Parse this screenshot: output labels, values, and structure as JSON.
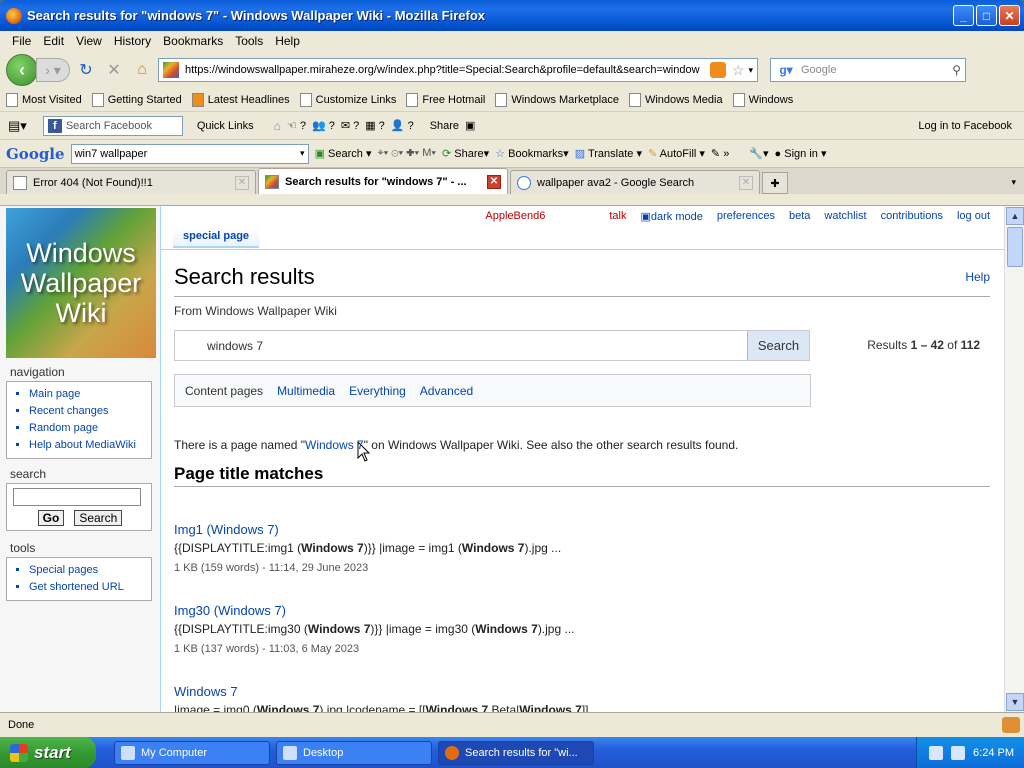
{
  "window": {
    "title": "Search results for \"windows 7\" - Windows Wallpaper Wiki - Mozilla Firefox"
  },
  "menu": [
    "File",
    "Edit",
    "View",
    "History",
    "Bookmarks",
    "Tools",
    "Help"
  ],
  "navbar": {
    "url": "https://windowswallpaper.miraheze.org/w/index.php?title=Special:Search&profile=default&search=window",
    "search_placeholder": "Google"
  },
  "bookmarks": [
    "Most Visited",
    "Getting Started",
    "Latest Headlines",
    "Customize Links",
    "Free Hotmail",
    "Windows Marketplace",
    "Windows Media",
    "Windows"
  ],
  "fbbar": {
    "search_placeholder": "Search Facebook",
    "quick_links": "Quick Links",
    "share": "Share",
    "login": "Log in to Facebook"
  },
  "gbar": {
    "logo": "Google",
    "query": "win7 wallpaper",
    "search": "Search",
    "share": "Share",
    "bookmarks": "Bookmarks",
    "translate": "Translate",
    "autofill": "AutoFill",
    "signin": "Sign in"
  },
  "tabs": [
    {
      "label": "Error 404 (Not Found)!!1"
    },
    {
      "label": "Search results for \"windows 7\" - ..."
    },
    {
      "label": "wallpaper ava2 - Google Search"
    }
  ],
  "sidebar": {
    "logo_lines": [
      "Windows",
      "Wallpaper",
      "Wiki"
    ],
    "navigation_title": "navigation",
    "navigation": [
      "Main page",
      "Recent changes",
      "Random page",
      "Help about MediaWiki"
    ],
    "search_title": "search",
    "go": "Go",
    "search": "Search",
    "tools_title": "tools",
    "tools": [
      "Special pages",
      "Get shortened URL"
    ]
  },
  "personal": {
    "user": "AppleBend6",
    "talk": "talk",
    "dark_mode": "dark mode",
    "preferences": "preferences",
    "beta": "beta",
    "watchlist": "watchlist",
    "contributions": "contributions",
    "logout": "log out"
  },
  "page": {
    "tab": "special page",
    "title": "Search results",
    "help": "Help",
    "from": "From Windows Wallpaper Wiki",
    "query": "windows 7",
    "search_button": "Search",
    "results_prefix": "Results ",
    "results_range": "1 – 42",
    "results_of": " of ",
    "results_total": "112",
    "profiles": [
      "Content pages",
      "Multimedia",
      "Everything",
      "Advanced"
    ],
    "notice_pre": "There is a page named \"",
    "notice_link": "Windows 7",
    "notice_post": "\" on Windows Wallpaper Wiki. See also the other search results found.",
    "section": "Page title matches"
  },
  "results": [
    {
      "title": "Img1 (Windows 7)",
      "snippet": [
        {
          "t": "{{DISPLAYTITLE:img1 (",
          "b": false
        },
        {
          "t": "Windows 7",
          "b": true
        },
        {
          "t": ")}} |image = img1 (",
          "b": false
        },
        {
          "t": "Windows 7",
          "b": true
        },
        {
          "t": ").jpg ...",
          "b": false
        }
      ],
      "meta": "1 KB (159 words) - 11:14, 29 June 2023"
    },
    {
      "title": "Img30 (Windows 7)",
      "snippet": [
        {
          "t": "{{DISPLAYTITLE:img30 (",
          "b": false
        },
        {
          "t": "Windows 7",
          "b": true
        },
        {
          "t": ")}} |image = img30 (",
          "b": false
        },
        {
          "t": "Windows 7",
          "b": true
        },
        {
          "t": ").jpg ...",
          "b": false
        }
      ],
      "meta": "1 KB (137 words) - 11:03, 6 May 2023"
    },
    {
      "title": "Windows 7",
      "snippet": [
        {
          "t": "|image = img0 (",
          "b": false
        },
        {
          "t": "Windows 7",
          "b": true
        },
        {
          "t": ").jpg |codename = [[",
          "b": false
        },
        {
          "t": "Windows 7",
          "b": true
        },
        {
          "t": " Beta|",
          "b": false
        },
        {
          "t": "Windows 7",
          "b": true
        },
        {
          "t": "]] ...",
          "b": false
        }
      ],
      "meta": ""
    }
  ],
  "status": "Done",
  "taskbar": {
    "start": "start",
    "tasks": [
      "My Computer",
      "Desktop",
      "Search results for \"wi..."
    ],
    "clock": "6:24 PM"
  }
}
